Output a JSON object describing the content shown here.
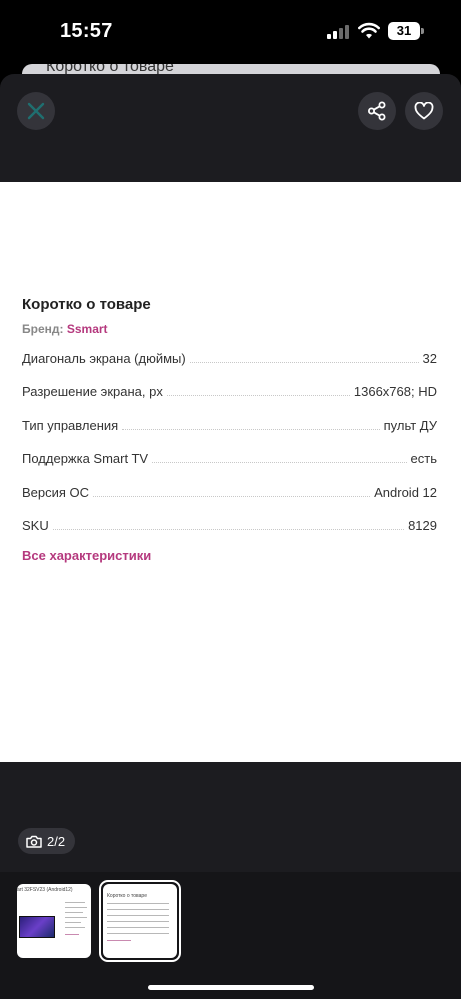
{
  "status_bar": {
    "time": "15:57",
    "battery": "31"
  },
  "background": {
    "sheet_title": "Коротко о товаре"
  },
  "gallery": {
    "counter": "2/2",
    "icons": {
      "close": "close-icon",
      "share": "share-icon",
      "favorite": "heart-icon",
      "camera": "camera-icon"
    }
  },
  "product_card": {
    "title": "Коротко о товаре",
    "brand_label": "Бренд:",
    "brand_value": "Ssmart",
    "specs": [
      {
        "name": "Диагональ экрана (дюймы)",
        "value": "32"
      },
      {
        "name": "Разрешение экрана, px",
        "value": "1366x768; HD"
      },
      {
        "name": "Тип управления",
        "value": "пульт ДУ"
      },
      {
        "name": "Поддержка Smart TV",
        "value": "есть"
      },
      {
        "name": "Версия ОС",
        "value": "Android 12"
      },
      {
        "name": "SKU",
        "value": "8129"
      }
    ],
    "all_specs_link": "Все характеристики"
  },
  "thumbnails": [
    {
      "caption": "art 32FSV23 (Android12)"
    },
    {
      "caption": "Коротко о товаре"
    }
  ],
  "colors": {
    "accent": "#b5397e",
    "close_icon": "#1f6f70",
    "modal_bg": "#1c1c20"
  }
}
